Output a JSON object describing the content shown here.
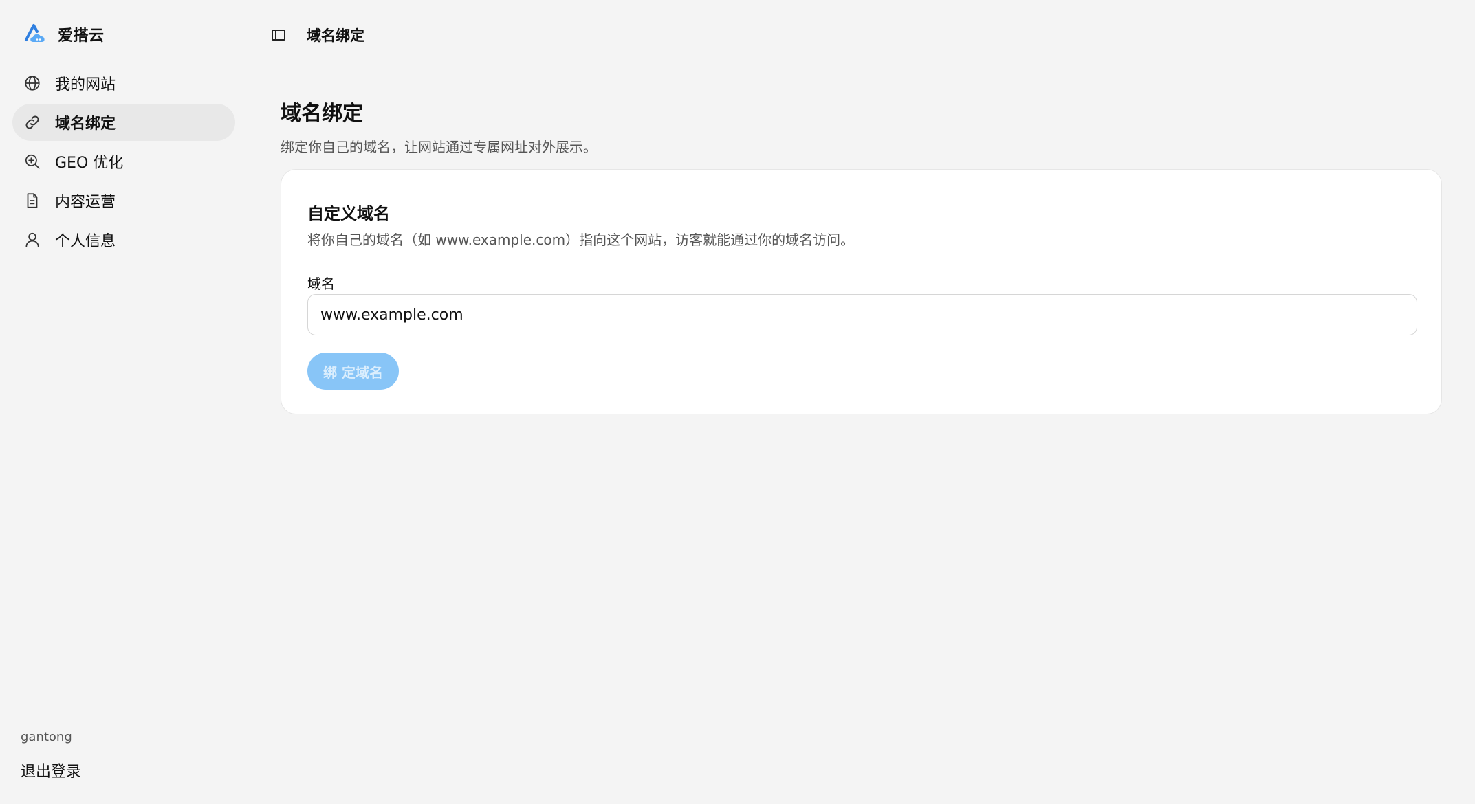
{
  "brand": {
    "name": "爱搭云",
    "logo_color": "#2f7fe0"
  },
  "sidebar": {
    "items": [
      {
        "label": "我的网站",
        "icon": "globe-icon",
        "active": false
      },
      {
        "label": "域名绑定",
        "icon": "link-icon",
        "active": true
      },
      {
        "label": "GEO 优化",
        "icon": "search-plus-icon",
        "active": false
      },
      {
        "label": "内容运营",
        "icon": "document-icon",
        "active": false
      },
      {
        "label": "个人信息",
        "icon": "user-icon",
        "active": false
      }
    ]
  },
  "user": {
    "name": "gantong",
    "logout_label": "退出登录"
  },
  "topbar": {
    "toggle_icon": "sidebar-toggle-icon",
    "breadcrumb": "域名绑定"
  },
  "page": {
    "title": "域名绑定",
    "subtitle": "绑定你自己的域名，让网站通过专属网址对外展示。"
  },
  "card": {
    "title": "自定义域名",
    "description": "将你自己的域名（如 www.example.com）指向这个网站，访客就能通过你的域名访问。",
    "field_label": "域名",
    "field_value": "www.example.com",
    "button_label": "绑 定域名",
    "button_color": "#88c5f7"
  }
}
